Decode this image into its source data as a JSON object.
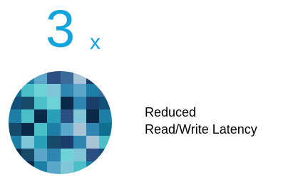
{
  "stat": {
    "number": "3",
    "unit": "x"
  },
  "caption": {
    "line1": "Reduced",
    "line2": "Read/Write Latency"
  },
  "colors": {
    "accent": "#12a4dd",
    "text": "#000000"
  },
  "image": {
    "icon": "pixelated-circle-icon"
  }
}
